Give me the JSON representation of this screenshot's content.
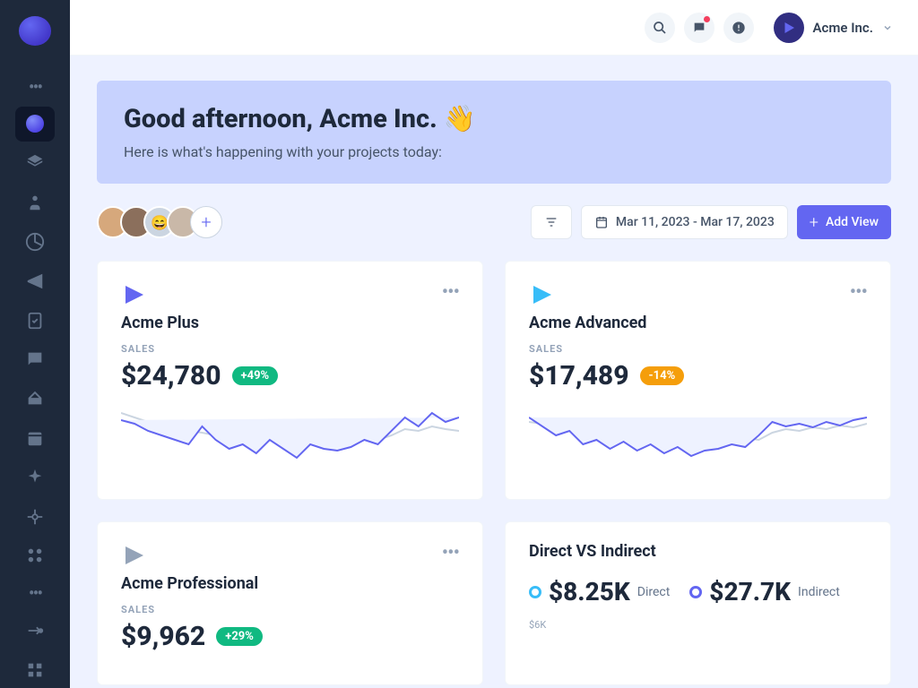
{
  "org": {
    "name": "Acme Inc."
  },
  "banner": {
    "title": "Good afternoon, Acme Inc. 👋",
    "subtitle": "Here is what's happening with your projects today:"
  },
  "toolbar": {
    "date_range": "Mar 11, 2023 - Mar 17, 2023",
    "add_view": "Add View"
  },
  "cards": {
    "plus": {
      "title": "Acme Plus",
      "label": "SALES",
      "value": "$24,780",
      "badge": "+49%",
      "badge_type": "pos",
      "brand": "#6366f1"
    },
    "advanced": {
      "title": "Acme Advanced",
      "label": "SALES",
      "value": "$17,489",
      "badge": "-14%",
      "badge_type": "neg",
      "brand": "#38bdf8"
    },
    "pro": {
      "title": "Acme Professional",
      "label": "SALES",
      "value": "$9,962",
      "badge": "+29%",
      "badge_type": "pos",
      "brand": "#64748b"
    },
    "compare": {
      "title": "Direct VS Indirect",
      "direct": {
        "value": "$8.25K",
        "label": "Direct",
        "color": "#38bdf8"
      },
      "indirect": {
        "value": "$27.7K",
        "label": "Indirect",
        "color": "#6366f1"
      },
      "axis_label": "$6K"
    }
  },
  "chart_data": [
    {
      "type": "line",
      "series": [
        {
          "name": "current",
          "values": [
            52,
            48,
            40,
            35,
            30,
            25,
            45,
            30,
            20,
            25,
            15,
            30,
            20,
            10,
            25,
            20,
            18,
            22,
            30,
            25,
            40,
            55,
            45,
            60,
            50
          ]
        },
        {
          "name": "previous",
          "values": [
            60,
            55,
            50,
            45,
            42,
            40,
            38,
            35,
            32,
            30,
            28,
            30,
            25,
            22,
            28,
            26,
            24,
            28,
            32,
            30,
            35,
            42,
            40,
            45,
            42
          ]
        }
      ],
      "ylim": [
        0,
        70
      ]
    },
    {
      "type": "line",
      "series": [
        {
          "name": "current",
          "values": [
            55,
            45,
            35,
            40,
            25,
            30,
            20,
            28,
            18,
            25,
            15,
            22,
            12,
            18,
            20,
            25,
            22,
            35,
            50,
            45,
            48,
            44,
            50,
            46,
            52
          ]
        },
        {
          "name": "previous",
          "values": [
            50,
            48,
            44,
            46,
            40,
            42,
            36,
            40,
            32,
            36,
            28,
            32,
            26,
            30,
            28,
            32,
            30,
            38,
            42,
            40,
            44,
            42,
            46,
            44,
            48
          ]
        }
      ],
      "ylim": [
        0,
        70
      ]
    }
  ]
}
